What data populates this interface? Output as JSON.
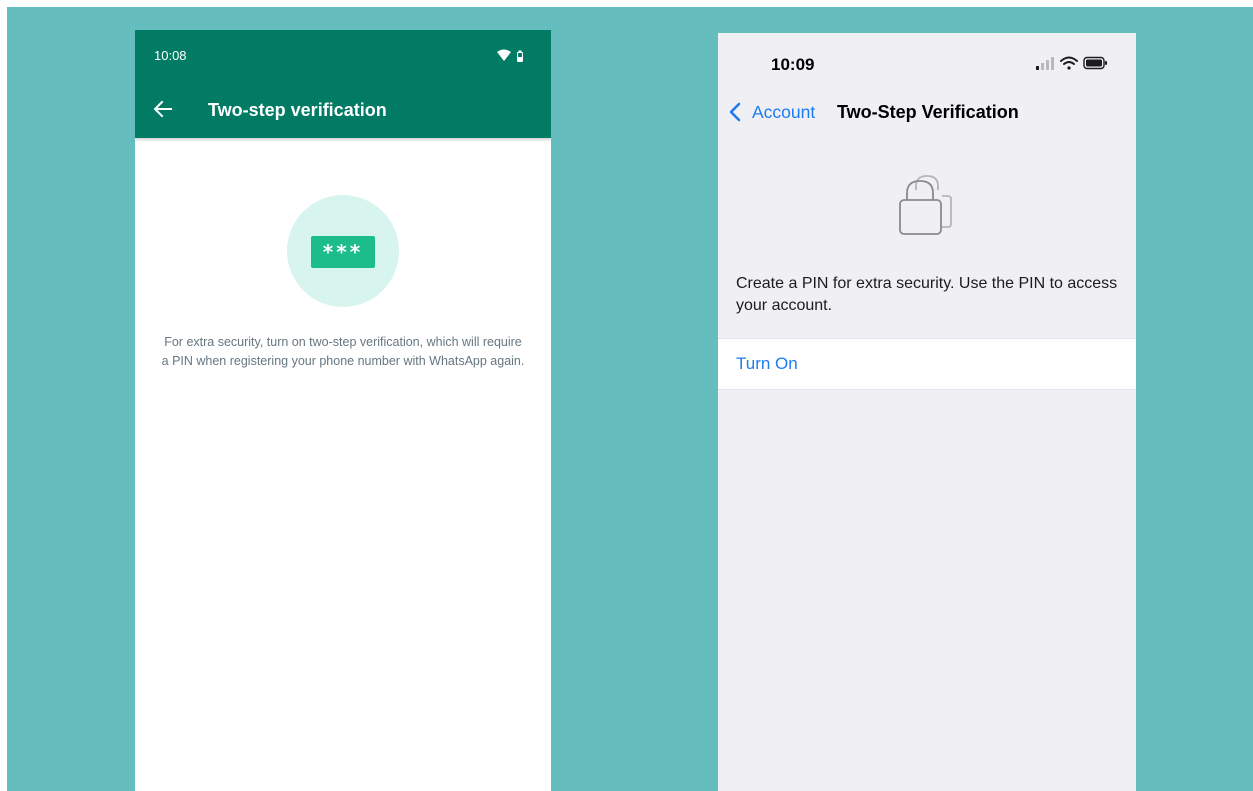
{
  "android": {
    "status": {
      "time": "10:08"
    },
    "app_bar": {
      "title": "Two-step verification"
    },
    "pin_graphic": {
      "text": "***"
    },
    "description": "For extra security, turn on two-step verification, which will require a PIN when registering your phone number with WhatsApp again.",
    "icons": {
      "back": "arrow-left-icon",
      "wifi": "wifi-icon",
      "battery": "battery-icon"
    },
    "colors": {
      "app_bar": "#027b65",
      "pin_box": "#1dbd8b",
      "pin_circle": "#d7f4ee"
    }
  },
  "ios": {
    "status": {
      "time": "10:09"
    },
    "nav": {
      "back_label": "Account",
      "title": "Two-Step Verification"
    },
    "description": "Create a PIN for extra security. Use the PIN to access your account.",
    "turn_on_label": "Turn On",
    "icons": {
      "back": "chevron-left-icon",
      "lock": "lock-icon",
      "signal": "signal-icon",
      "wifi": "wifi-icon",
      "battery": "battery-icon"
    },
    "colors": {
      "accent": "#1d7cf2",
      "background": "#efeff4"
    }
  },
  "background_color": "#65bdbd"
}
